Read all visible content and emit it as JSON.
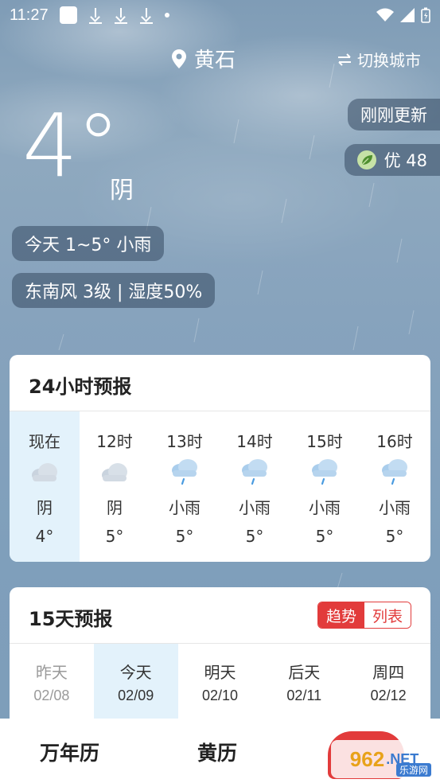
{
  "status_bar": {
    "time": "11:27"
  },
  "header": {
    "city": "黄石",
    "switch_city": "切换城市"
  },
  "current": {
    "temperature": "4°",
    "condition": "阴",
    "updated": "刚刚更新",
    "aqi": "优 48",
    "today_summary": "今天 1~5°  小雨",
    "wind_humidity": "东南风 3级  |  湿度50%"
  },
  "hourly": {
    "title": "24小时预报",
    "items": [
      {
        "time": "现在",
        "desc": "阴",
        "temp": "4°",
        "icon": "cloudy-icon"
      },
      {
        "time": "12时",
        "desc": "阴",
        "temp": "5°",
        "icon": "cloudy-icon"
      },
      {
        "time": "13时",
        "desc": "小雨",
        "temp": "5°",
        "icon": "light-rain-icon"
      },
      {
        "time": "14时",
        "desc": "小雨",
        "temp": "5°",
        "icon": "light-rain-icon"
      },
      {
        "time": "15时",
        "desc": "小雨",
        "temp": "5°",
        "icon": "light-rain-icon"
      },
      {
        "time": "16时",
        "desc": "小雨",
        "temp": "5°",
        "icon": "light-rain-icon"
      }
    ]
  },
  "daily": {
    "title": "15天预报",
    "toggle": {
      "trend": "趋势",
      "list": "列表"
    },
    "items": [
      {
        "day": "昨天",
        "date": "02/08"
      },
      {
        "day": "今天",
        "date": "02/09"
      },
      {
        "day": "明天",
        "date": "02/10"
      },
      {
        "day": "后天",
        "date": "02/11"
      },
      {
        "day": "周四",
        "date": "02/12"
      }
    ]
  },
  "bottom_nav": {
    "item1": "万年历",
    "item2": "黄历"
  },
  "watermark": {
    "number": "962",
    "net": ".NET",
    "sub": "乐游网"
  },
  "colors": {
    "accent": "#e23b3b",
    "highlight": "#e3f2fb",
    "pill": "#344860"
  }
}
